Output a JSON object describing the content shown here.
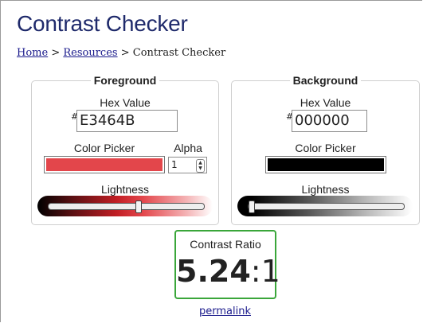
{
  "page": {
    "title": "Contrast Checker"
  },
  "breadcrumb": {
    "home": "Home",
    "sep1": " > ",
    "resources": "Resources",
    "sep2": " > ",
    "current": "Contrast Checker"
  },
  "foreground": {
    "legend": "Foreground",
    "hex_label": "Hex Value",
    "hash": "#",
    "hex_value": "E3464B",
    "picker_label": "Color Picker",
    "color": "#E3464B",
    "alpha_label": "Alpha",
    "alpha_value": "1",
    "lightness_label": "Lightness"
  },
  "background": {
    "legend": "Background",
    "hex_label": "Hex Value",
    "hash": "#",
    "hex_value": "000000",
    "picker_label": "Color Picker",
    "color": "#000000",
    "lightness_label": "Lightness"
  },
  "contrast": {
    "label": "Contrast Ratio",
    "value": "5.24",
    "suffix": ":1",
    "status_color": "#3aa63a"
  },
  "permalink": "permalink"
}
